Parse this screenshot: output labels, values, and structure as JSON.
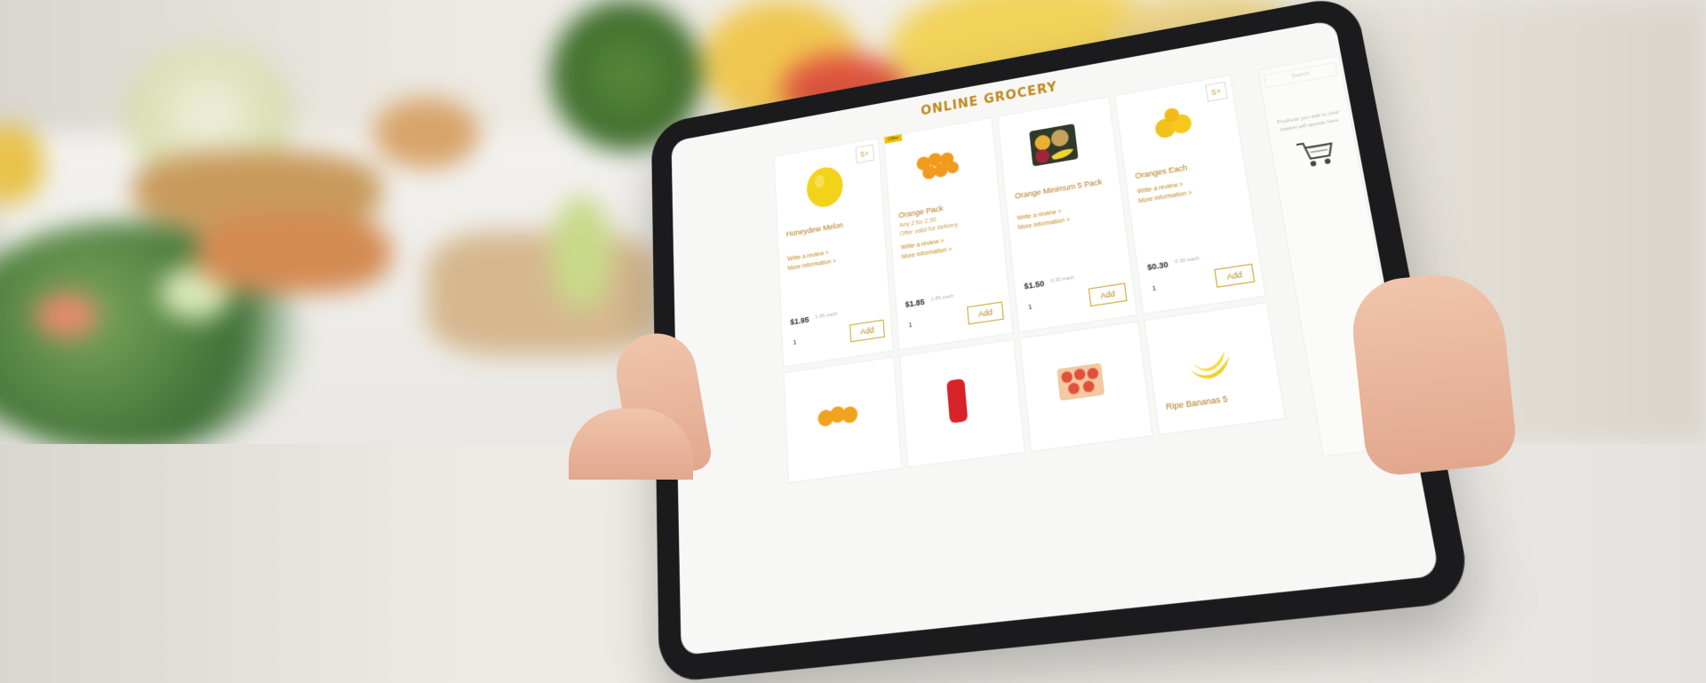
{
  "app": {
    "title": "ONLINE GROCERY"
  },
  "products": [
    {
      "name": "Honeydew Melon",
      "badge": "5+",
      "offer": "",
      "detail": "",
      "links": [
        "Write a review >",
        "More information >"
      ],
      "price": "$1.95",
      "each": "1.95 each",
      "qty": "1",
      "add": "Add",
      "fruit": "melon"
    },
    {
      "name": "Orange Pack",
      "badge": "",
      "offer": "Offer",
      "detail": "Any 2 for  2.90",
      "detail2": "Offer valid for delivery",
      "links": [
        "Write a review >",
        "More information >"
      ],
      "price": "$1.85",
      "each": "1.85 each",
      "qty": "1",
      "add": "Add",
      "fruit": "oranges"
    },
    {
      "name": "Orange Minimum 5 Pack",
      "badge": "",
      "offer": "",
      "detail": "",
      "links": [
        "Write a review >",
        "More information >"
      ],
      "price": "$1.50",
      "each": "0.30 each",
      "qty": "1",
      "add": "Add",
      "fruit": "mixed"
    },
    {
      "name": "Oranges Each",
      "badge": "5+",
      "offer": "",
      "detail": "",
      "links": [
        "Write a review >",
        "More information >"
      ],
      "price": "$0.30",
      "each": "0.30 each",
      "qty": "1",
      "add": "Add",
      "fruit": "lemons"
    }
  ],
  "products_row2": [
    {
      "name": "",
      "fruit": "orange-net"
    },
    {
      "name": "",
      "fruit": "red-net"
    },
    {
      "name": "",
      "fruit": "tomatoes"
    },
    {
      "name": "Ripe Bananas 5",
      "fruit": "bananas"
    }
  ],
  "sidebar": {
    "search_placeholder": "Search",
    "empty_message": "Products you add to your basket will appear here",
    "cart_icon": "cart-icon"
  },
  "colors": {
    "accent": "#c08a1e",
    "button_border": "#c9a227",
    "bezel": "#1b1b1d"
  }
}
